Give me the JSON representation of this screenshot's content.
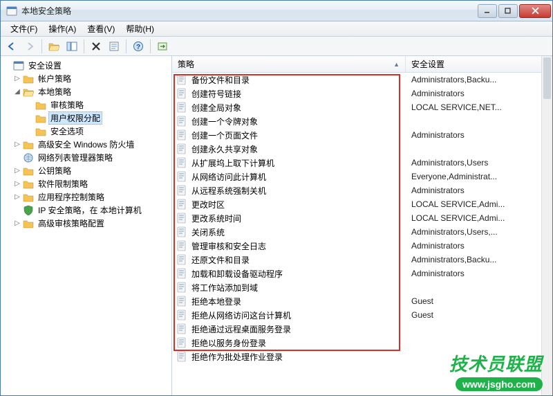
{
  "window": {
    "title": "本地安全策略"
  },
  "menu": {
    "file": "文件(F)",
    "action": "操作(A)",
    "view": "查看(V)",
    "help": "帮助(H)"
  },
  "tree": {
    "root": "安全设置",
    "n_account": "帐户策略",
    "n_local": "本地策略",
    "n_audit": "审核策略",
    "n_userrights": "用户权限分配",
    "n_secopts": "安全选项",
    "n_wfas": "高级安全 Windows 防火墙",
    "n_nlm": "网络列表管理器策略",
    "n_pk": "公钥策略",
    "n_srp": "软件限制策略",
    "n_acp": "应用程序控制策略",
    "n_ipsec": "IP 安全策略，在 本地计算机",
    "n_advaudit": "高级审核策略配置"
  },
  "headers": {
    "policy": "策略",
    "setting": "安全设置"
  },
  "rows": [
    {
      "p": "备份文件和目录",
      "s": "Administrators,Backu..."
    },
    {
      "p": "创建符号链接",
      "s": "Administrators"
    },
    {
      "p": "创建全局对象",
      "s": "LOCAL SERVICE,NET..."
    },
    {
      "p": "创建一个令牌对象",
      "s": ""
    },
    {
      "p": "创建一个页面文件",
      "s": "Administrators"
    },
    {
      "p": "创建永久共享对象",
      "s": ""
    },
    {
      "p": "从扩展坞上取下计算机",
      "s": "Administrators,Users"
    },
    {
      "p": "从网络访问此计算机",
      "s": "Everyone,Administrat..."
    },
    {
      "p": "从远程系统强制关机",
      "s": "Administrators"
    },
    {
      "p": "更改时区",
      "s": "LOCAL SERVICE,Admi..."
    },
    {
      "p": "更改系统时间",
      "s": "LOCAL SERVICE,Admi..."
    },
    {
      "p": "关闭系统",
      "s": "Administrators,Users,..."
    },
    {
      "p": "管理审核和安全日志",
      "s": "Administrators"
    },
    {
      "p": "还原文件和目录",
      "s": "Administrators,Backu..."
    },
    {
      "p": "加载和卸载设备驱动程序",
      "s": "Administrators"
    },
    {
      "p": "将工作站添加到域",
      "s": ""
    },
    {
      "p": "拒绝本地登录",
      "s": "Guest"
    },
    {
      "p": "拒绝从网络访问这台计算机",
      "s": "Guest"
    },
    {
      "p": "拒绝通过远程桌面服务登录",
      "s": ""
    },
    {
      "p": "拒绝以服务身份登录",
      "s": ""
    },
    {
      "p": "拒绝作为批处理作业登录",
      "s": ""
    }
  ],
  "watermark": {
    "line1": "技术员联盟",
    "line2": "www.jsgho.com"
  }
}
